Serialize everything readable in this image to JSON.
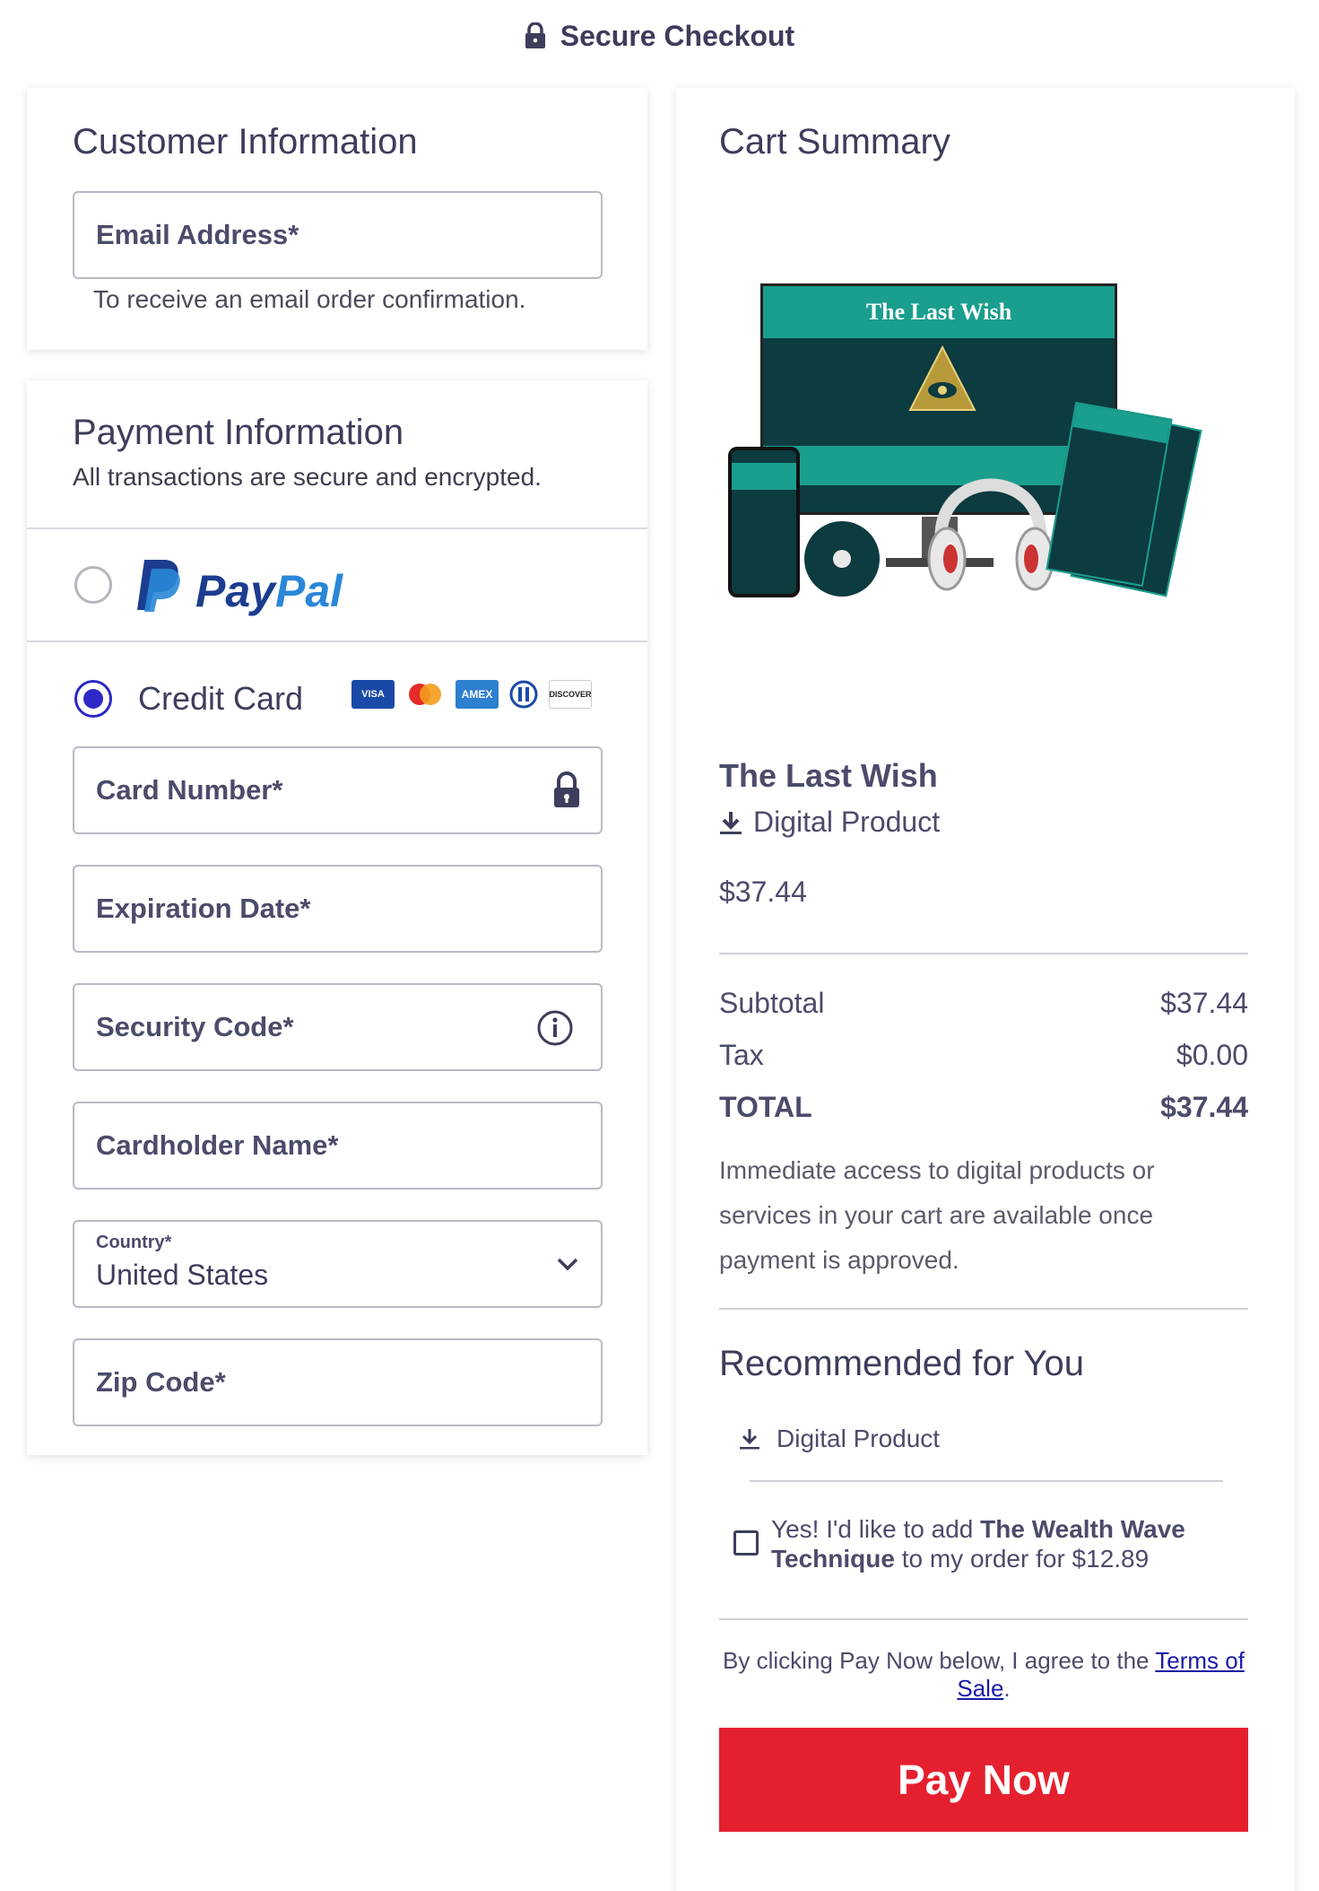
{
  "header": {
    "title": "Secure Checkout",
    "icon": "lock-icon"
  },
  "customer": {
    "title": "Customer Information",
    "email_placeholder": "Email Address*",
    "email_helper": "To receive an email order confirmation."
  },
  "payment": {
    "title": "Payment Information",
    "subtitle": "All transactions are secure and encrypted.",
    "paypal_label": "PayPal",
    "credit_card_label": "Credit Card",
    "card_brands": [
      "VISA",
      "mastercard",
      "AMEX",
      "diners",
      "DISCOVER"
    ],
    "fields": {
      "card_number": "Card Number*",
      "expiration": "Expiration Date*",
      "security_code": "Security Code*",
      "cardholder": "Cardholder Name*",
      "country_label": "Country*",
      "country_value": "United States",
      "zip": "Zip Code*"
    },
    "selected_method": "Credit Card"
  },
  "cart": {
    "title": "Cart Summary",
    "product_image_title": "The Last Wish",
    "product_name": "The Last Wish",
    "product_type": "Digital Product",
    "product_price": "$37.44",
    "subtotal_label": "Subtotal",
    "subtotal_value": "$37.44",
    "tax_label": "Tax",
    "tax_value": "$0.00",
    "total_label": "TOTAL",
    "total_value": "$37.44",
    "access_note": "Immediate access to digital products or services in your cart are available once payment is approved.",
    "recommended_title": "Recommended for You",
    "recommended_type": "Digital Product",
    "upsell_prefix": "Yes! I'd like to add ",
    "upsell_product": "The Wealth Wave Technique",
    "upsell_suffix": " to my order for $12.89",
    "terms_prefix": "By clicking Pay Now below, I agree to the ",
    "terms_link": "Terms of Sale",
    "terms_suffix": ".",
    "pay_button": "Pay Now"
  },
  "colors": {
    "accent": "#2d28c7",
    "pay_button": "#e5202e",
    "teal": "#1a9e8e"
  }
}
